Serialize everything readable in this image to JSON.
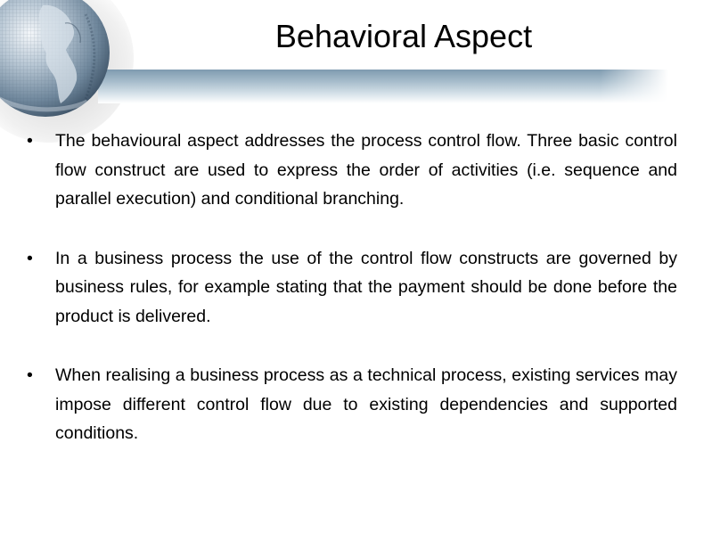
{
  "slide": {
    "title": "Behavioral Aspect",
    "bullet_glyph": "•",
    "bullets": [
      {
        "text": "The behavioural aspect addresses the process control flow. Three basic control flow construct are used to express the order of activities (i.e. sequence and parallel execution) and conditional branching."
      },
      {
        "text": "In a business process the use of the control flow constructs are governed by business rules, for example stating that the payment should be done before the product is delivered."
      },
      {
        "text": "When realising a business process as a technical process, existing services may impose different control flow due to existing dependencies  and supported conditions."
      }
    ]
  },
  "theme": {
    "band_color": "#7f9bb0",
    "globe_color": "#6f879c",
    "text_color": "#000000",
    "background": "#ffffff"
  }
}
